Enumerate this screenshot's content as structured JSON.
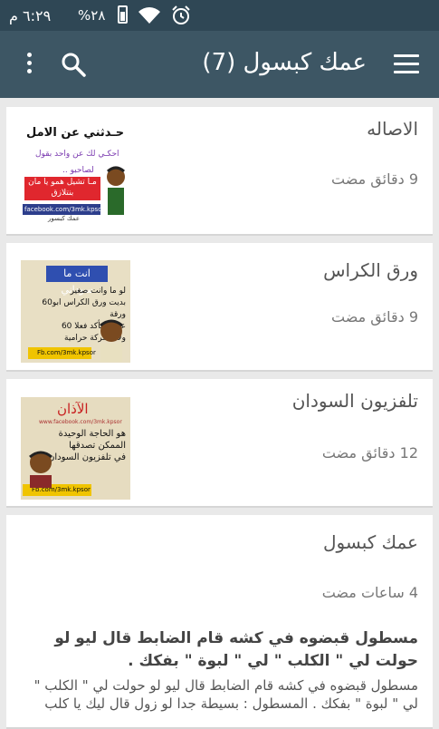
{
  "status_bar": {
    "time": "٦:٢٩ م",
    "battery": "%٢٨",
    "icons": [
      "battery-icon",
      "wifi-icon",
      "alarm-icon"
    ]
  },
  "app_bar": {
    "title": "عمك كبسول (7)",
    "icons": [
      "overflow-menu-icon",
      "search-icon",
      "hamburger-menu-icon"
    ]
  },
  "posts": [
    {
      "title": "الاصاله",
      "time": "9 دقائق مضت",
      "thumb": {
        "heading": "حـدثني عن الامل",
        "line1": "احكـي لك عن واحد بقول",
        "line2": "لصاحبو ..",
        "red_text": "مـا تشيل همو يا مان بنتلازق",
        "facebook": "facebook.com/3mk.kpsor",
        "signature": "عمك كبسور"
      }
    },
    {
      "title": "ورق الكراس",
      "time": "9 دقائق مضت",
      "thumb": {
        "heading": "انت ما سوداني",
        "lines": [
          "لو ما وانت صغير",
          "بديت ورق الكراس ابو60 ورقة",
          "عشان تأكد فعلا 60",
          "ولا الشركة حرامية"
        ],
        "facebook": "Fb.com/3mk.kpsor"
      }
    },
    {
      "title": "تلفزيون السودان",
      "time": "12 دقائق مضت",
      "thumb": {
        "heading": "الآذان",
        "url": "www.facebook.com/3mk.kpsor",
        "lines": [
          "هو الحاجة الوحيدة",
          "الممكن تصدقها",
          "في تلفزيون السودان"
        ],
        "facebook": "Fb.com/3mk.kpsor"
      }
    },
    {
      "title": "عمك كبسول",
      "time": "4 ساعات مضت"
    },
    {
      "title": "مسطول قبضوه في كشه قام الضابط قال ليو لو حولت لي \" الكلب \" لي \" لبوة \" بفكك .",
      "body": "مسطول قبضوه في كشه قام الضابط قال ليو لو حولت لي \" الكلب \" لي \" لبوة \" بفكك . المسطول : بسيطة جدا لو زول قال ليك يا كلب"
    }
  ],
  "colors": {
    "status_bar": "#2f4755",
    "app_bar": "#3d5664",
    "background": "#e9e9e9",
    "card": "#ffffff"
  }
}
